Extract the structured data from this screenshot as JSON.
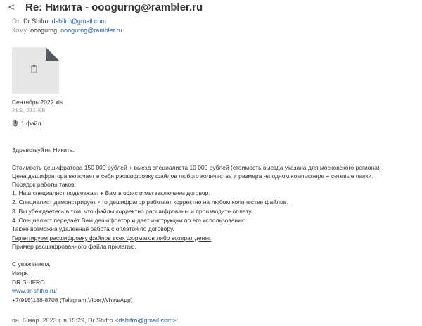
{
  "header": {
    "back_glyph": "<",
    "subject": "Re: Никита - ooogurng@rambler.ru",
    "star_glyph": "☆",
    "from_label": "От",
    "from_name": "Dr Shifro",
    "from_email": "dshifro@gmail.com",
    "to_label": "Кому",
    "to_name": "ooogurng",
    "to_email": "ooogurng@rambler.ru"
  },
  "attachment": {
    "name": "Сентябрь 2022.xls",
    "meta": "XLS, 211 KB",
    "count_label": "1 файл"
  },
  "body": {
    "greeting": "Здравствуйте, Никита.",
    "line1": "Стоимость дешифратора 150 000 рублей + выезд специалиста 10 000 рублей (стоимость выезда указана для московского региона)",
    "line2": "Цена дешифратора включает в себя расшифровку файлов любого количества и размера на одном компьютере + сетевые папки.",
    "line3": "Порядок работы таков:",
    "step1": "1. Наш специалист подъезжает к Вам в офис и мы заключаем договор.",
    "step2": "2. Специалист демонстрирует, что дешифратор работает корректно на любом количестве файлов.",
    "step3": "3. Вы убеждаетесь в том, что файлы корректно расшифрованы и производите оплату.",
    "step4": "4. Специалист передаёт Вам дешифратор и дает инструкции по его использованию.",
    "remote": "Также возможна удаленная работа с оплатой по договору.",
    "guarantee": "Гарантируем расшифровку файлов всех форматов либо возврат денег.",
    "example": "Пример расшифрованного файла прилагаю.",
    "regards": "С уважением,",
    "name": "Игорь.",
    "company": "DR.SHIFRO",
    "website": "www.dr-shifro.ru/",
    "phone": "+7(915)188-8708 (Telegram,Viber,WhatsApp)"
  },
  "quote": {
    "prefix": "пн, 6 мар. 2023 г. в 15:29, Dr Shifro <",
    "email": "dshifro@gmail.com",
    "suffix": ">:"
  },
  "colors": {
    "link": "#2f5f9e",
    "file_bg": "#e6e6e6",
    "fold": "#555a60"
  }
}
